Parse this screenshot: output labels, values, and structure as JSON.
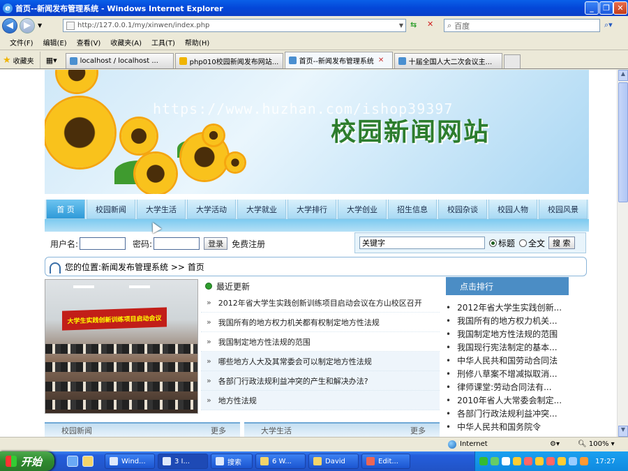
{
  "window": {
    "title": "首页--新闻发布管理系统 - Windows Internet Explorer",
    "minimize": "_",
    "maximize": "❐",
    "close": "✕"
  },
  "address": {
    "url": "http://127.0.0.1/my/xinwen/index.php",
    "search_placeholder": "百度"
  },
  "menu": [
    "文件(F)",
    "编辑(E)",
    "查看(V)",
    "收藏夹(A)",
    "工具(T)",
    "帮助(H)"
  ],
  "favorites_label": "收藏夹",
  "tabs": [
    {
      "label": "localhost / localhost ..."
    },
    {
      "label": "php010校园新闻发布网站..."
    },
    {
      "label": "首页--新闻发布管理系统",
      "active": true
    },
    {
      "label": "十届全国人大二次会议主..."
    }
  ],
  "banner": {
    "site_title": "校园新闻网站",
    "watermark": "https://www.huzhan.com/ishop39397"
  },
  "nav": [
    "首 页",
    "校园新闻",
    "大学生活",
    "大学活动",
    "大学就业",
    "大学排行",
    "大学创业",
    "招生信息",
    "校园杂谈",
    "校园人物",
    "校园风景"
  ],
  "login": {
    "username_label": "用户名:",
    "password_label": "密码:",
    "login_button": "登录",
    "register_link": "免费注册"
  },
  "search": {
    "keyword_value": "关键字",
    "option_title": "标题",
    "option_fulltext": "全文",
    "button": "搜 索"
  },
  "breadcrumb": {
    "prefix": "您的位置:",
    "path": "新闻发布管理系统 >> 首页"
  },
  "photo": {
    "banner_text": "大学生实践创新训练项目启动会议"
  },
  "latest": {
    "heading": "最近更新",
    "items": [
      "2012年省大学生实践创新训练项目启动会议在方山校区召开",
      "我国所有的地方权力机关都有权制定地方性法规",
      "我国制定地方性法规的范围",
      "哪些地方人大及其常委会可以制定地方性法规",
      "各部门行政法规利益冲突的产生和解决办法?",
      "地方性法规"
    ]
  },
  "ranking": {
    "heading": "点击排行",
    "items": [
      "2012年省大学生实践创新...",
      "我国所有的地方权力机关...",
      "我国制定地方性法规的范围",
      "我国现行宪法制定的基本...",
      "中华人民共和国劳动合同法",
      "刑修八草案不增减拟取消...",
      "律师课堂:劳动合同法有...",
      "2010年省人大常委会制定...",
      "各部门行政法规利益冲突...",
      "中华人民共和国务院令"
    ]
  },
  "bottom_sections": [
    {
      "title": "校园新闻",
      "more": "更多"
    },
    {
      "title": "大学生活",
      "more": "更多"
    }
  ],
  "status": {
    "zone": "Internet",
    "zoom": "100%"
  },
  "taskbar": {
    "start": "开始",
    "tasks": [
      "Wind...",
      "3 I...",
      "搜索",
      "6 W...",
      "David",
      "Edit..."
    ],
    "clock": "17:27"
  }
}
